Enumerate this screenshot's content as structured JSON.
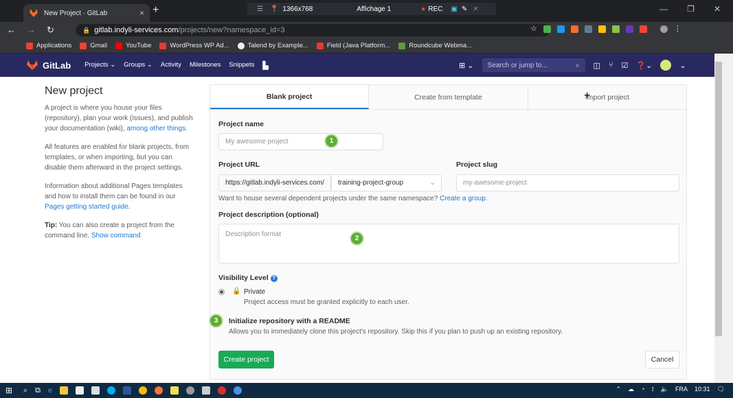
{
  "browser": {
    "tab_title": "New Project · GitLab",
    "new_tab": "+",
    "tab_close": "×",
    "resolution": "1366x768",
    "display_label": "Affichage 1",
    "rec_label": "REC",
    "url_host": "gitlab.indyli-services.com",
    "url_path": "/projects/new?namespace_id=3",
    "bookmarks": [
      "Applications",
      "Gmail",
      "YouTube",
      "WordPress WP Ad...",
      "Talend by Example...",
      "Field (Java Platform...",
      "Roundcube Webma..."
    ]
  },
  "gitlab_nav": {
    "brand": "GitLab",
    "links": [
      "Projects ⌄",
      "Groups ⌄",
      "Activity",
      "Milestones",
      "Snippets"
    ],
    "search_placeholder": "Search or jump to..."
  },
  "info": {
    "title": "New project",
    "p1_text": "A project is where you house your files (repository), plan your work (issues), and publish your documentation (wiki), ",
    "p1_link": "among other things",
    "p1_end": ".",
    "p2": "All features are enabled for blank projects, from templates, or when importing, but you can disable them afterward in the project settings.",
    "p3_text": "Information about additional Pages templates and how to install them can be found in our ",
    "p3_link": "Pages getting started guide",
    "p3_end": ".",
    "tip_label": "Tip:",
    "tip_text": " You can also create a project from the command line. ",
    "tip_link": "Show command"
  },
  "tabs": [
    "Blank project",
    "Create from template",
    "Import project"
  ],
  "form": {
    "project_name_label": "Project name",
    "project_name_placeholder": "My awesome project",
    "project_url_label": "Project URL",
    "url_prefix": "https://gitlab.indyli-services.com/",
    "namespace": "training-project-group",
    "slug_label": "Project slug",
    "slug_placeholder": "my-awesome-project",
    "group_help": "Want to house several dependent projects under the same namespace? ",
    "group_link": "Create a group.",
    "description_label": "Project description (optional)",
    "description_placeholder": "Description format",
    "visibility_label": "Visibility Level",
    "private_label": "Private",
    "private_help": "Project access must be granted explicitly to each user.",
    "readme_label": "Initialize repository with a README",
    "readme_help": "Allows you to immediately clone this project's repository. Skip this if you plan to push up an existing repository.",
    "create_button": "Create project",
    "cancel_button": "Cancel"
  },
  "annotations": [
    "1",
    "2",
    "3"
  ],
  "taskbar": {
    "lang": "FRA",
    "time": "10:31"
  }
}
